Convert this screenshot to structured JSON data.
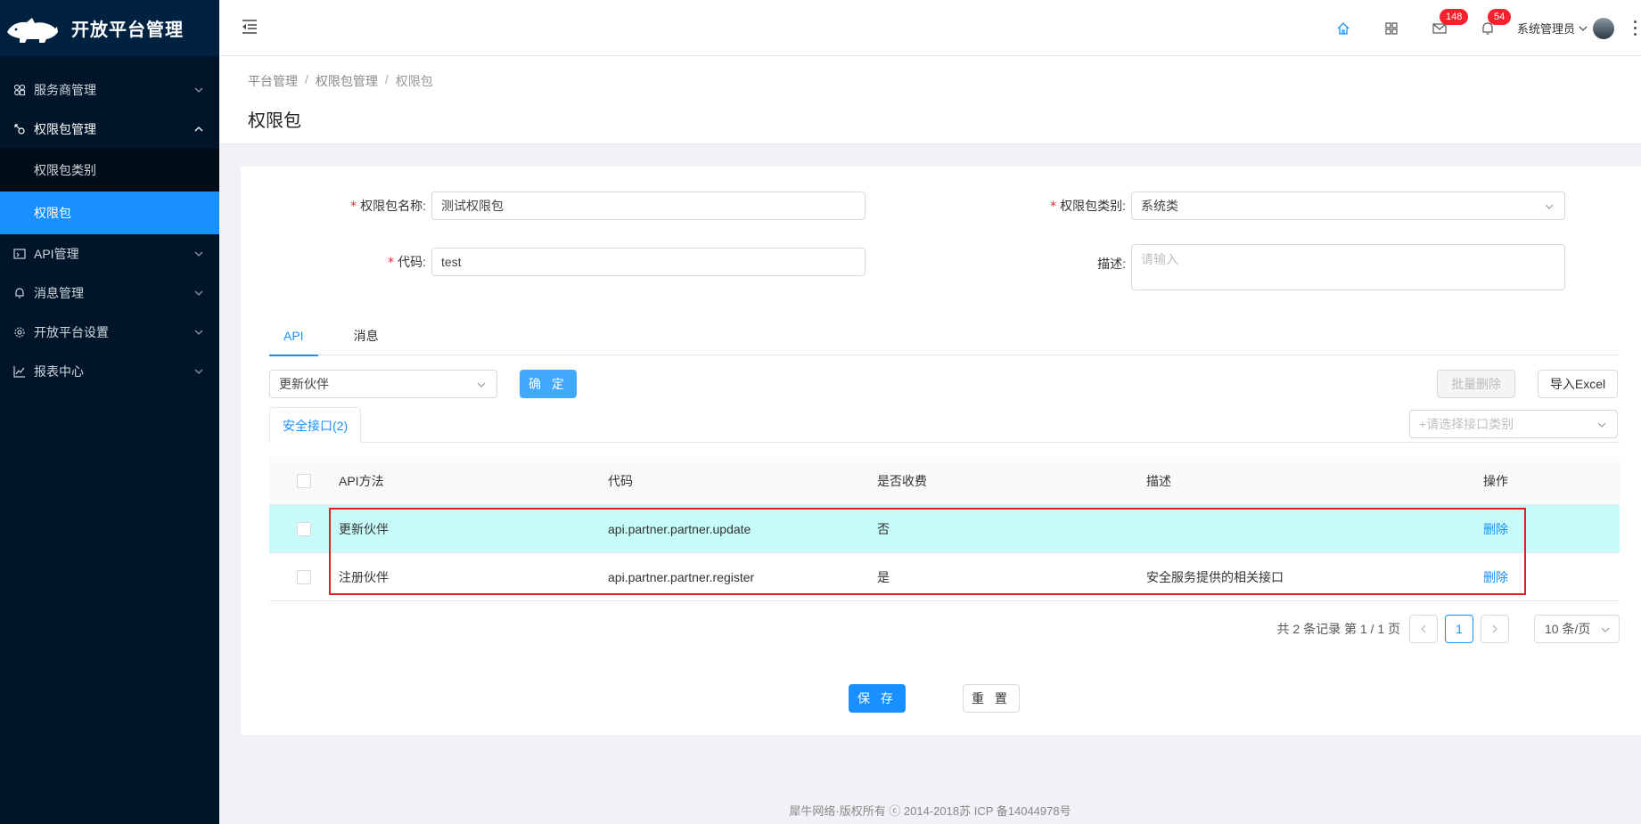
{
  "sidebar": {
    "app_title": "开放平台管理",
    "menu": [
      {
        "label": "服务商管理",
        "icon": "group-icon"
      },
      {
        "label": "权限包管理",
        "icon": "key-icon"
      },
      {
        "label": "API管理",
        "icon": "code-icon"
      },
      {
        "label": "消息管理",
        "icon": "bell-icon"
      },
      {
        "label": "开放平台设置",
        "icon": "gear-icon"
      },
      {
        "label": "报表中心",
        "icon": "chart-icon"
      }
    ],
    "submenu": [
      {
        "label": "权限包类别"
      },
      {
        "label": "权限包",
        "active": true
      }
    ]
  },
  "header": {
    "mail_count": "148",
    "notify_count": "54",
    "user_name": "系统管理员"
  },
  "breadcrumb": [
    "平台管理",
    "权限包管理",
    "权限包"
  ],
  "page_title": "权限包",
  "form": {
    "name_label": "权限包名称:",
    "name_value": "测试权限包",
    "category_label": "权限包类别:",
    "category_value": "系统类",
    "code_label": "代码:",
    "code_value": "test",
    "desc_label": "描述:",
    "desc_placeholder": "请输入"
  },
  "tabs": [
    {
      "label": "API",
      "active": true
    },
    {
      "label": "消息",
      "active": false
    }
  ],
  "toolbar": {
    "select_value": "更新伙伴",
    "confirm_label": "确 定",
    "batch_delete_label": "批量删除",
    "import_label": "导入Excel",
    "category_tab": "安全接口(2)",
    "category_select_placeholder": "+请选择接口类别"
  },
  "table": {
    "headers": {
      "method": "API方法",
      "code": "代码",
      "fee": "是否收费",
      "desc": "描述",
      "op": "操作"
    },
    "rows": [
      {
        "method": "更新伙伴",
        "code": "api.partner.partner.update",
        "fee": "否",
        "desc": "",
        "op": "删除"
      },
      {
        "method": "注册伙伴",
        "code": "api.partner.partner.register",
        "fee": "是",
        "desc": "安全服务提供的相关接口",
        "op": "删除"
      }
    ]
  },
  "pagination": {
    "summary": "共 2 条记录 第 1 / 1 页",
    "current": "1",
    "page_size": "10 条/页"
  },
  "actions": {
    "save_label": "保 存",
    "reset_label": "重 置"
  },
  "footer": "犀牛网络·版权所有 ⓒ 2014-2018苏 ICP 备14044978号"
}
